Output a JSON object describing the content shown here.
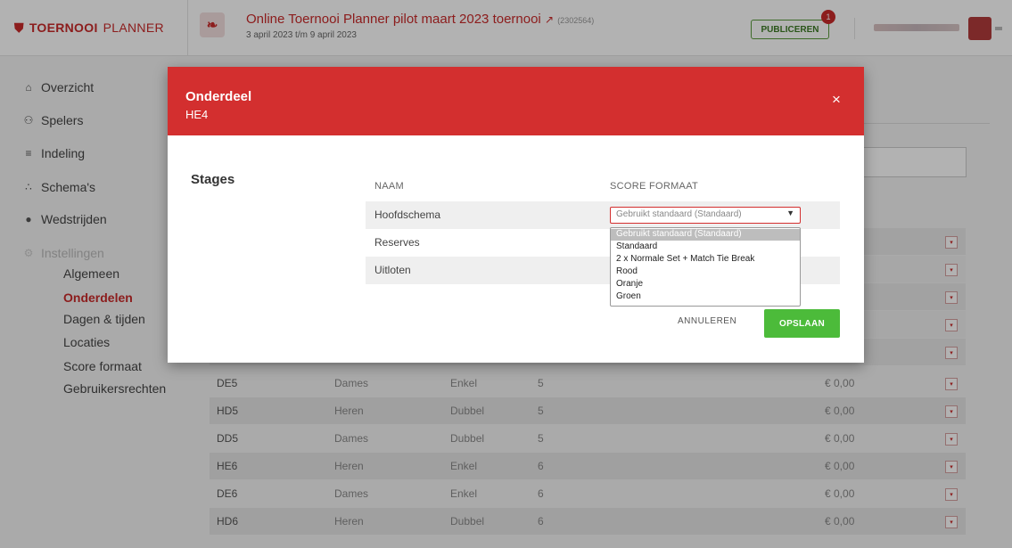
{
  "brand": {
    "word1": "TOERNOOI",
    "word2": "PLANNER"
  },
  "tournament": {
    "title": "Online Toernooi Planner pilot maart 2023 toernooi",
    "id": "(2302564)",
    "dates": "3 april 2023 t/m 9 april 2023"
  },
  "publish": {
    "label": "PUBLICEREN",
    "badge": "1"
  },
  "nav": {
    "overzicht": "Overzicht",
    "spelers": "Spelers",
    "indeling": "Indeling",
    "schemas": "Schema's",
    "wedstrijden": "Wedstrijden",
    "instellingen": "Instellingen",
    "sub": {
      "algemeen": "Algemeen",
      "onderdelen": "Onderdelen",
      "dagen": "Dagen & tijden",
      "locaties": "Locaties",
      "score": "Score formaat",
      "rechten": "Gebruikersrechten"
    }
  },
  "table": {
    "rows": [
      {
        "code": "DE5",
        "gender": "Dames",
        "type": "Enkel",
        "level": "5",
        "price": "€ 0,00"
      },
      {
        "code": "HD5",
        "gender": "Heren",
        "type": "Dubbel",
        "level": "5",
        "price": "€ 0,00"
      },
      {
        "code": "DD5",
        "gender": "Dames",
        "type": "Dubbel",
        "level": "5",
        "price": "€ 0,00"
      },
      {
        "code": "HE6",
        "gender": "Heren",
        "type": "Enkel",
        "level": "6",
        "price": "€ 0,00"
      },
      {
        "code": "DE6",
        "gender": "Dames",
        "type": "Enkel",
        "level": "6",
        "price": "€ 0,00"
      },
      {
        "code": "HD6",
        "gender": "Heren",
        "type": "Dubbel",
        "level": "6",
        "price": "€ 0,00"
      }
    ]
  },
  "modal": {
    "title": "Onderdeel",
    "subtitle": "HE4",
    "close": "×",
    "stages_label": "Stages",
    "col_name": "NAAM",
    "col_score": "SCORE FORMAAT",
    "stages": [
      "Hoofdschema",
      "Reserves",
      "Uitloten"
    ],
    "select_value": "Gebruikt standaard (Standaard)",
    "options": [
      "Gebruikt standaard (Standaard)",
      "Standaard",
      "2 x Normale Set + Match Tie Break",
      "Rood",
      "Oranje",
      "Groen"
    ],
    "cancel": "ANNULEREN",
    "save": "OPSLAAN"
  },
  "colors": {
    "brand_red": "#d32f2f",
    "save_green": "#4cbb3a"
  },
  "icons": {
    "close": "close-icon",
    "external": "external-link-icon",
    "dropdown": "chevron-down-icon",
    "home": "home-icon",
    "users": "users-icon",
    "list": "list-icon",
    "tree": "schema-tree-icon",
    "ball": "ball-icon",
    "gear": "gear-icon",
    "row_menu": "row-menu-icon"
  }
}
